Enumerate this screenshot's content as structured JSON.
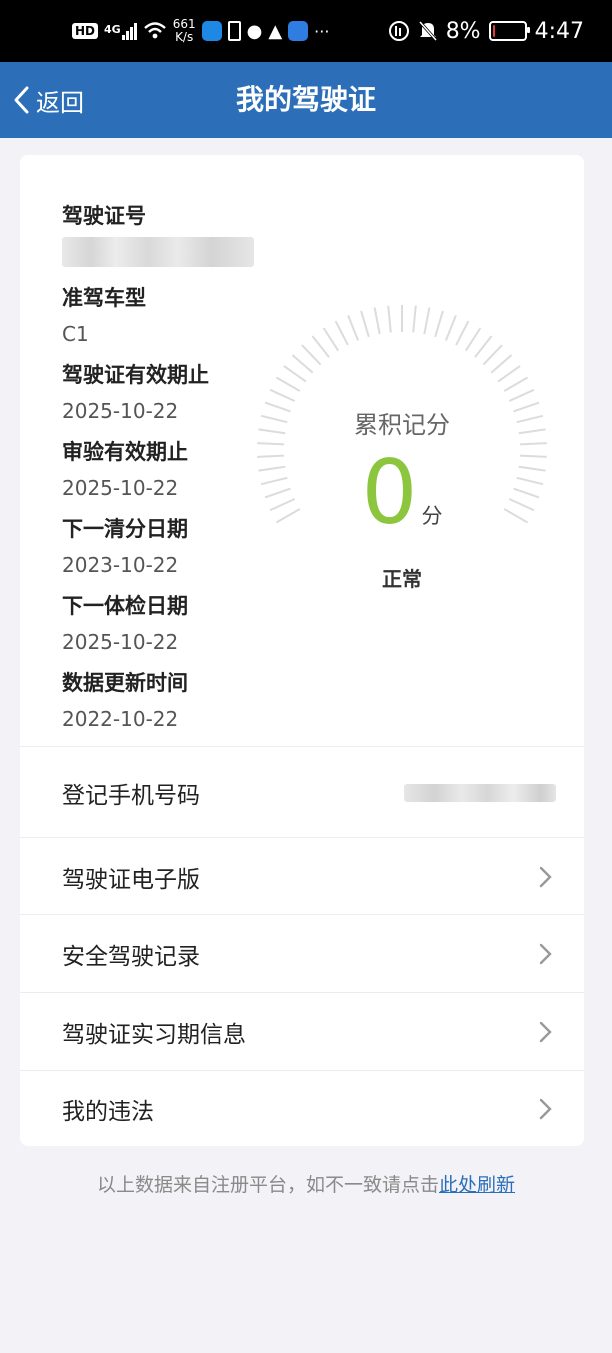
{
  "status_bar": {
    "hd": "HD",
    "signal": "4G",
    "speed_value": "661",
    "speed_unit": "K/s",
    "more": "···",
    "battery": "8%",
    "time": "4:47"
  },
  "nav": {
    "back_label": "返回",
    "title": "我的驾驶证"
  },
  "info": [
    {
      "label": "驾驶证号",
      "value": ""
    },
    {
      "label": "准驾车型",
      "value": "C1"
    },
    {
      "label": "驾驶证有效期止",
      "value": "2025-10-22"
    },
    {
      "label": "审验有效期止",
      "value": "2025-10-22"
    },
    {
      "label": "下一清分日期",
      "value": "2023-10-22"
    },
    {
      "label": "下一体检日期",
      "value": "2025-10-22"
    },
    {
      "label": "数据更新时间",
      "value": "2022-10-22"
    }
  ],
  "gauge": {
    "label": "累积记分",
    "score": "0",
    "unit": "分",
    "status": "正常",
    "color": "#8cc63f"
  },
  "rows": {
    "phone_label": "登记手机号码",
    "electronic_license": "驾驶证电子版",
    "safe_driving": "安全驾驶记录",
    "probation_info": "驾驶证实习期信息",
    "violations": "我的违法"
  },
  "footer": {
    "text": "以上数据来自注册平台，如不一致请点击",
    "link": "此处刷新"
  },
  "colors": {
    "nav_bg": "#2c6fb8",
    "accent": "#8cc63f",
    "battery_low": "#e23b3b"
  }
}
